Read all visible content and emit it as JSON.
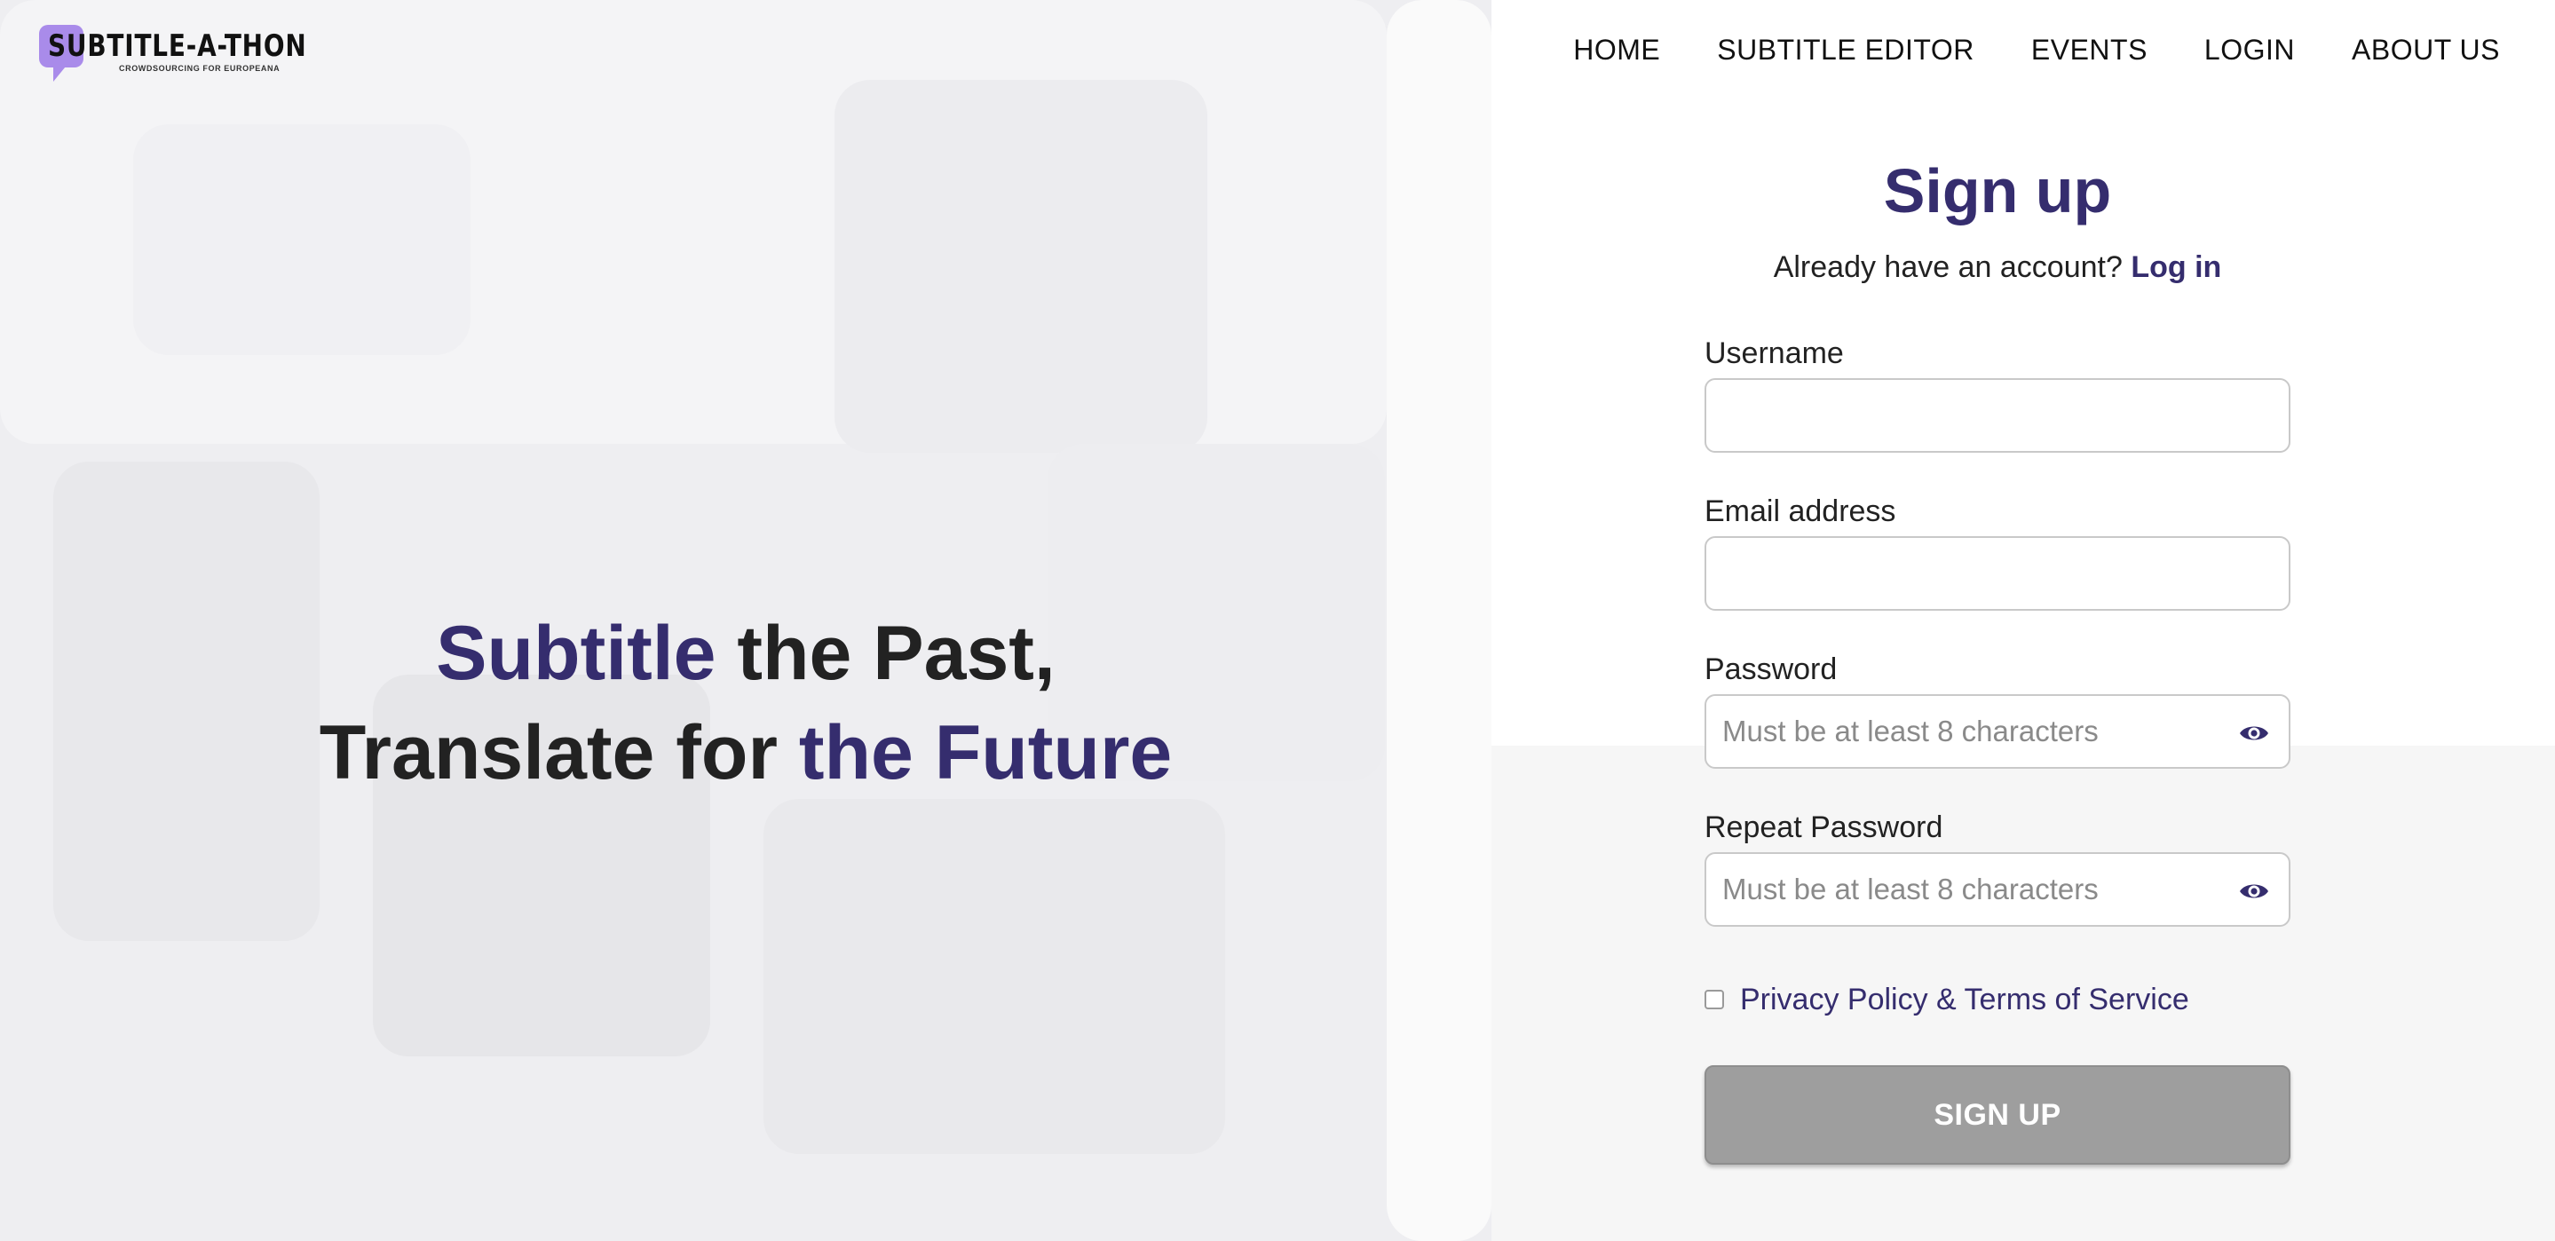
{
  "logo": {
    "wordmark": "SUBTITLE-A-THON",
    "tagline": "CROWDSOURCING FOR EUROPEANA"
  },
  "nav": {
    "items": [
      "HOME",
      "SUBTITLE EDITOR",
      "EVENTS",
      "LOGIN",
      "ABOUT US"
    ]
  },
  "hero": {
    "line1_accent": "Subtitle",
    "line1_rest": " the Past,",
    "line2_start": "Translate for ",
    "line2_accent": "the Future"
  },
  "form": {
    "title": "Sign up",
    "subtitle_text": "Already have an account? ",
    "login_link": "Log in",
    "username": {
      "label": "Username",
      "value": "",
      "placeholder": ""
    },
    "email": {
      "label": "Email address",
      "value": "",
      "placeholder": ""
    },
    "password": {
      "label": "Password",
      "value": "",
      "placeholder": "Must be at least 8 characters"
    },
    "repeat_password": {
      "label": "Repeat Password",
      "value": "",
      "placeholder": "Must be at least 8 characters"
    },
    "terms_label": "Privacy Policy & Terms of Service",
    "terms_checked": false,
    "submit_label": "SIGN UP"
  },
  "colors": {
    "accent": "#352d6e",
    "logo_bubble": "#a98bea",
    "button_disabled": "#9e9e9e"
  },
  "icons": {
    "show_password": "eye-icon"
  }
}
